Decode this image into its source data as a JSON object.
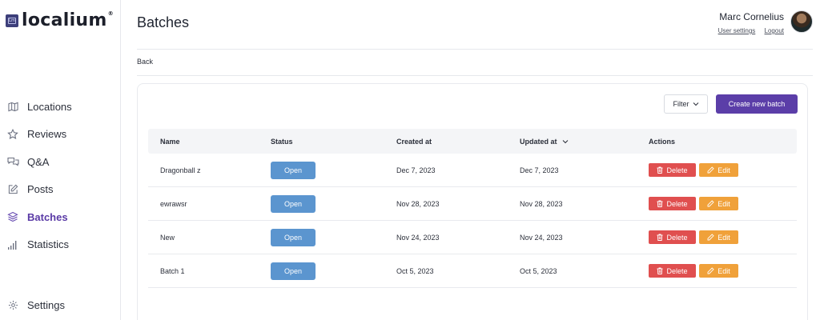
{
  "brand": {
    "name": "localium",
    "mark": "Lm",
    "reg": "®"
  },
  "sidebar": {
    "items": [
      {
        "label": "Locations",
        "icon": "map-icon"
      },
      {
        "label": "Reviews",
        "icon": "star-icon"
      },
      {
        "label": "Q&A",
        "icon": "chat-bubbles-icon"
      },
      {
        "label": "Posts",
        "icon": "edit-icon"
      },
      {
        "label": "Batches",
        "icon": "layers-icon",
        "active": true
      },
      {
        "label": "Statistics",
        "icon": "bar-chart-icon"
      }
    ],
    "settings": {
      "label": "Settings",
      "icon": "gear-icon"
    }
  },
  "header": {
    "title": "Batches",
    "user": {
      "name": "Marc Cornelius",
      "settings_link": "User settings",
      "logout_link": "Logout"
    }
  },
  "back_label": "Back",
  "toolbar": {
    "filter_label": "Filter",
    "create_label": "Create new batch"
  },
  "table": {
    "columns": [
      "Name",
      "Status",
      "Created at",
      "Updated at",
      "Actions"
    ],
    "rows": [
      {
        "name": "Dragonball z",
        "status": "Open",
        "created": "Dec 7, 2023",
        "updated": "Dec 7, 2023"
      },
      {
        "name": "ewrawsr",
        "status": "Open",
        "created": "Nov 28, 2023",
        "updated": "Nov 28, 2023"
      },
      {
        "name": "New",
        "status": "Open",
        "created": "Nov 24, 2023",
        "updated": "Nov 24, 2023"
      },
      {
        "name": "Batch 1",
        "status": "Open",
        "created": "Oct 5, 2023",
        "updated": "Oct 5, 2023"
      }
    ],
    "delete_label": "Delete",
    "edit_label": "Edit"
  },
  "colors": {
    "accent": "#5b3ea8",
    "status": "#5b95cf",
    "delete": "#e04f4f",
    "edit": "#f0a13a"
  }
}
